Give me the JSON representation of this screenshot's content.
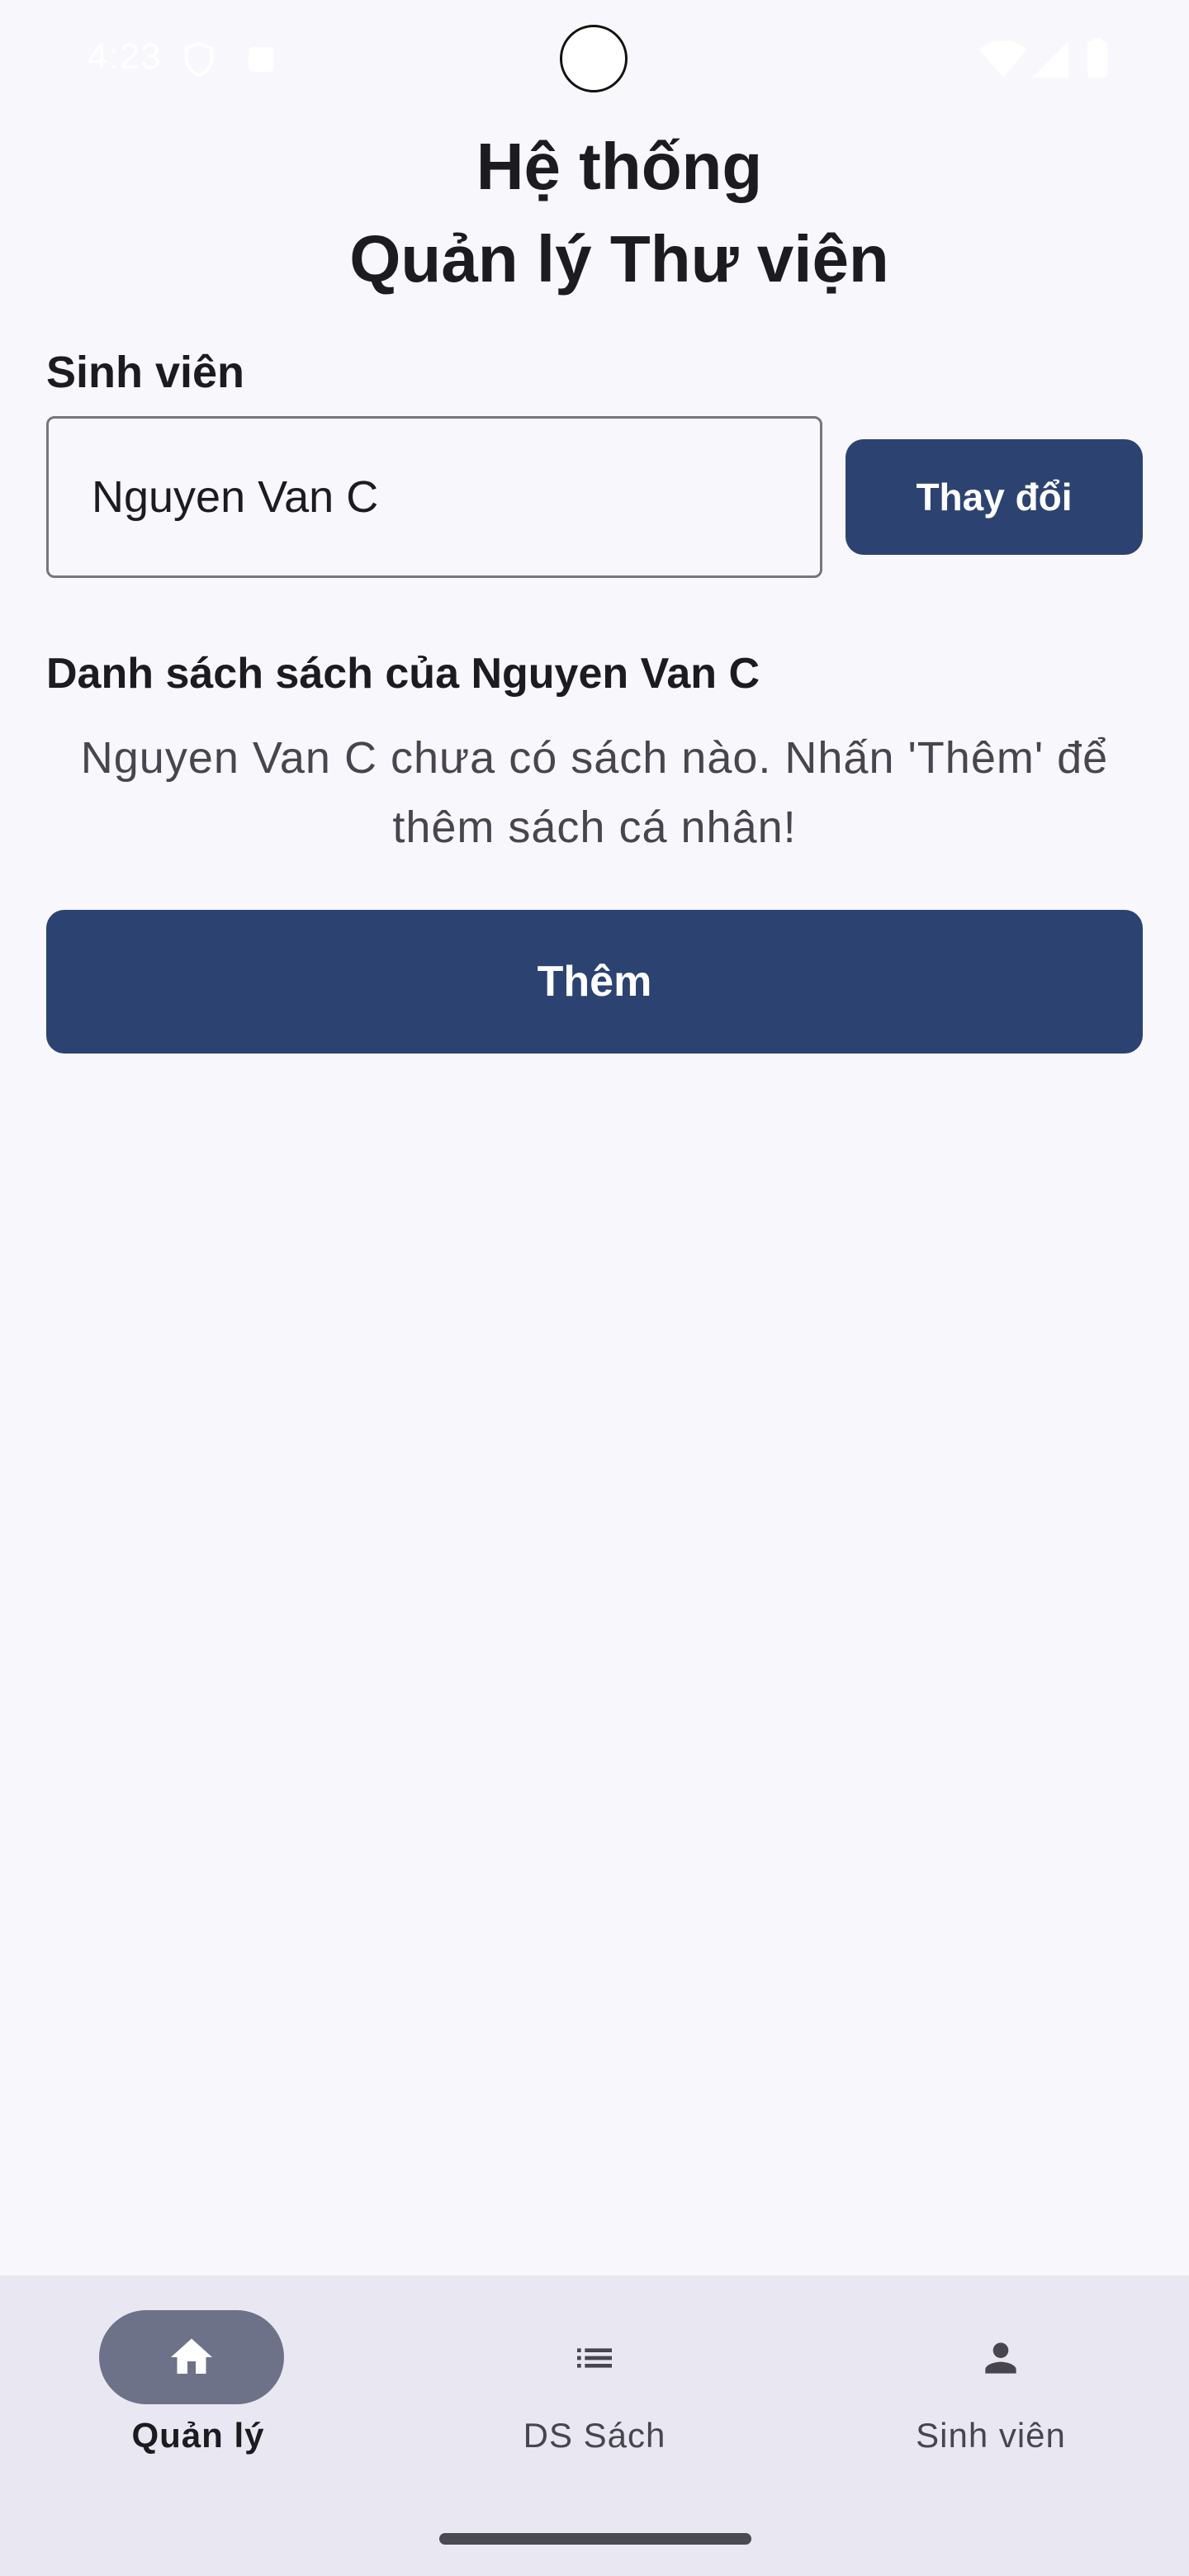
{
  "status_bar": {
    "time": "4:23"
  },
  "header": {
    "title_line1": "Hệ thống",
    "title_line2": "Quản lý Thư viện"
  },
  "student": {
    "label": "Sinh viên",
    "value": "Nguyen Van C",
    "change_button": "Thay đổi"
  },
  "books": {
    "section_title": "Danh sách sách của Nguyen Van C",
    "empty_line1": "Nguyen Van C chưa có sách nào. Nhấn 'Thêm' để",
    "empty_line2": "thêm sách cá nhân!",
    "add_button": "Thêm"
  },
  "bottom_nav": {
    "items": [
      {
        "label": "Quản lý",
        "icon": "home-icon",
        "active": true
      },
      {
        "label": "DS Sách",
        "icon": "list-icon",
        "active": false
      },
      {
        "label": "Sinh viên",
        "icon": "person-icon",
        "active": false
      }
    ]
  },
  "colors": {
    "primary": "#2c4372",
    "background": "#f8f7fc",
    "nav_background": "#e9e8f2",
    "nav_active_pill": "#6e7289"
  }
}
